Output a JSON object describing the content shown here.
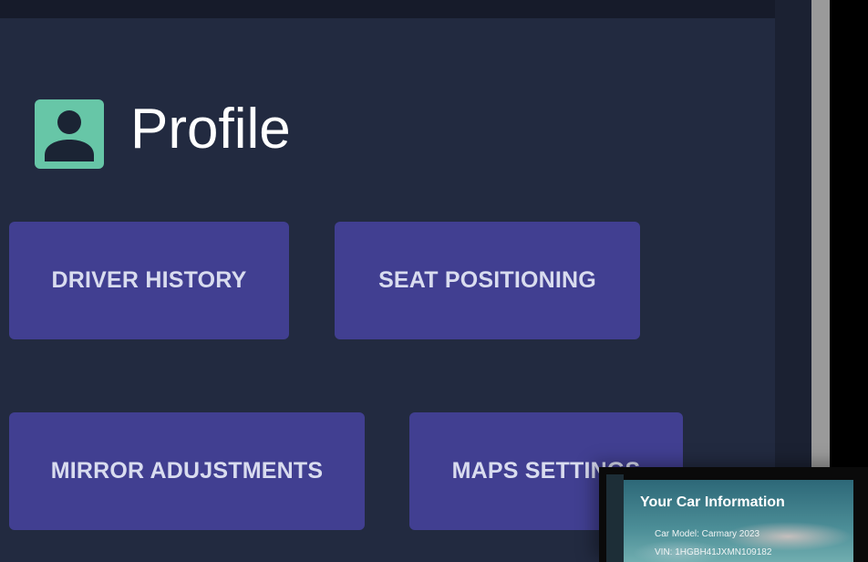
{
  "page": {
    "title": "Profile"
  },
  "menu": {
    "driver_history": "DRIVER HISTORY",
    "seat_positioning": "SEAT POSITIONING",
    "mirror_adjustments": "MIRROR ADUJSTMENTS",
    "maps_settings": "MAPS SETTINGS"
  },
  "car_info": {
    "title": "Your Car Information",
    "model": "Car Model: Carmary 2023",
    "vin": "VIN: 1HGBH41JXMN109182"
  },
  "icons": {
    "profile": "user-avatar-icon"
  },
  "colors": {
    "background": "#222a40",
    "button": "#413f91",
    "avatar": "#67c6a7"
  }
}
